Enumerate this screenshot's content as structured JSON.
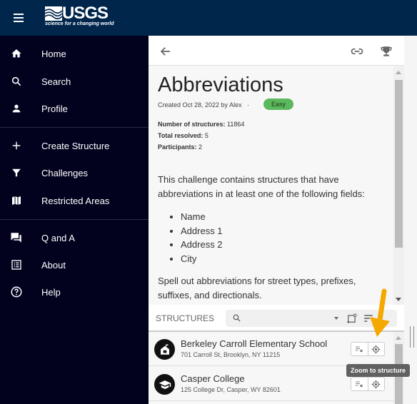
{
  "app": {
    "logo_text": "USGS",
    "logo_tagline": "science for a changing world"
  },
  "sidebar": {
    "items": [
      {
        "label": "Home",
        "icon": "home-icon"
      },
      {
        "label": "Search",
        "icon": "search-icon"
      },
      {
        "label": "Profile",
        "icon": "person-icon"
      },
      {
        "label": "Create Structure",
        "icon": "plus-icon"
      },
      {
        "label": "Challenges",
        "icon": "filter-icon"
      },
      {
        "label": "Restricted Areas",
        "icon": "map-icon"
      },
      {
        "label": "Q and A",
        "icon": "forum-icon"
      },
      {
        "label": "About",
        "icon": "list-icon"
      },
      {
        "label": "Help",
        "icon": "help-icon"
      }
    ]
  },
  "challenge": {
    "title": "Abbreviations",
    "created": "Created Oct 28, 2022 by Alex",
    "separator": "·",
    "difficulty": "Easy",
    "stats": [
      {
        "label": "Number of structures:",
        "value": "11864"
      },
      {
        "label": "Total resolved:",
        "value": "5"
      },
      {
        "label": "Participants:",
        "value": "2"
      }
    ],
    "description_intro": "This challenge contains structures that have abbreviations in at least one of the following fields:",
    "fields": [
      "Name",
      "Address 1",
      "Address 2",
      "City"
    ],
    "description_outro": "Spell out abbreviations for street types, prefixes, suffixes, and directionals."
  },
  "structures": {
    "label": "STRUCTURES",
    "search_placeholder": "",
    "items": [
      {
        "name": "Berkeley Carroll Elementary School",
        "address": "701 Carroll St, Brooklyn, NY 11215",
        "icon": "school-icon"
      },
      {
        "name": "Casper College",
        "address": "125 College Dr, Casper, WY 82601",
        "icon": "graduation-cap-icon"
      }
    ]
  },
  "tooltip": "Zoom to structure",
  "colors": {
    "topbar": "#00264c",
    "sidebar": "#02021f",
    "badge": "#5cb85c",
    "annotation_arrow": "#f5a800"
  }
}
